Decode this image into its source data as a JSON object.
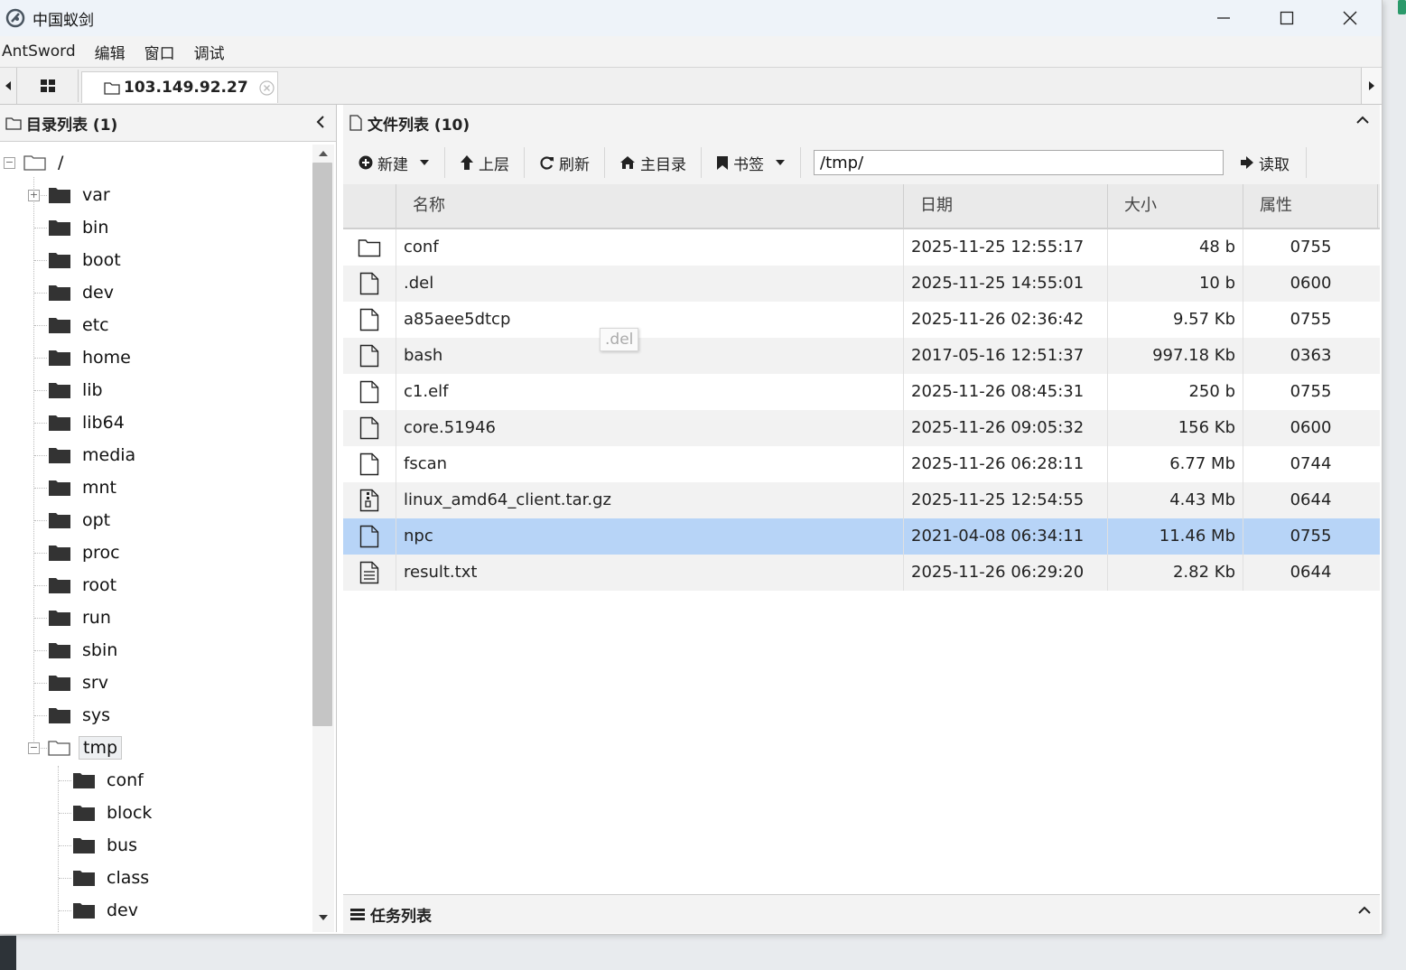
{
  "window": {
    "title": "中国蚁剑"
  },
  "menu": [
    "AntSword",
    "编辑",
    "窗口",
    "调试"
  ],
  "tabs": {
    "host": "103.149.92.27"
  },
  "left_panel": {
    "header": "目录列表 (1)",
    "tree_root": "/",
    "root_children": [
      "var",
      "bin",
      "boot",
      "dev",
      "etc",
      "home",
      "lib",
      "lib64",
      "media",
      "mnt",
      "opt",
      "proc",
      "root",
      "run",
      "sbin",
      "srv",
      "sys",
      "tmp"
    ],
    "tmp_children": [
      "conf",
      "block",
      "bus",
      "class",
      "dev"
    ]
  },
  "right_panel": {
    "header": "文件列表 (10)",
    "toolbar": {
      "new": "新建",
      "up": "上层",
      "refresh": "刷新",
      "home": "主目录",
      "bookmark": "书签",
      "path": "/tmp/",
      "read": "读取"
    },
    "columns": {
      "name": "名称",
      "date": "日期",
      "size": "大小",
      "attr": "属性"
    },
    "files": [
      {
        "icon": "folder-icon",
        "name": "conf",
        "date": "2025-11-25 12:55:17",
        "size": "48 b",
        "attr": "0755"
      },
      {
        "icon": "file-icon",
        "name": ".del",
        "date": "2025-11-25 14:55:01",
        "size": "10 b",
        "attr": "0600"
      },
      {
        "icon": "file-icon",
        "name": "a85aee5dtcp",
        "date": "2025-11-26 02:36:42",
        "size": "9.57 Kb",
        "attr": "0755"
      },
      {
        "icon": "file-icon",
        "name": "bash",
        "date": "2017-05-16 12:51:37",
        "size": "997.18 Kb",
        "attr": "0363"
      },
      {
        "icon": "file-icon",
        "name": "c1.elf",
        "date": "2025-11-26 08:45:31",
        "size": "250 b",
        "attr": "0755"
      },
      {
        "icon": "file-icon",
        "name": "core.51946",
        "date": "2025-11-26 09:05:32",
        "size": "156 Kb",
        "attr": "0600"
      },
      {
        "icon": "file-icon",
        "name": "fscan",
        "date": "2025-11-26 06:28:11",
        "size": "6.77 Mb",
        "attr": "0744"
      },
      {
        "icon": "archive-icon",
        "name": "linux_amd64_client.tar.gz",
        "date": "2025-11-25 12:54:55",
        "size": "4.43 Mb",
        "attr": "0644"
      },
      {
        "icon": "file-icon",
        "name": "npc",
        "date": "2021-04-08 06:34:11",
        "size": "11.46 Mb",
        "attr": "0755"
      },
      {
        "icon": "text-file-icon",
        "name": "result.txt",
        "date": "2025-11-26 06:29:20",
        "size": "2.82 Kb",
        "attr": "0644"
      }
    ],
    "selected_index": 8,
    "tooltip": ".del"
  },
  "task_panel": {
    "header": "任务列表"
  },
  "colors": {
    "selection": "#b7d4f7",
    "alt_row": "#f2f2f2",
    "header_bg": "#f3f3f3"
  }
}
